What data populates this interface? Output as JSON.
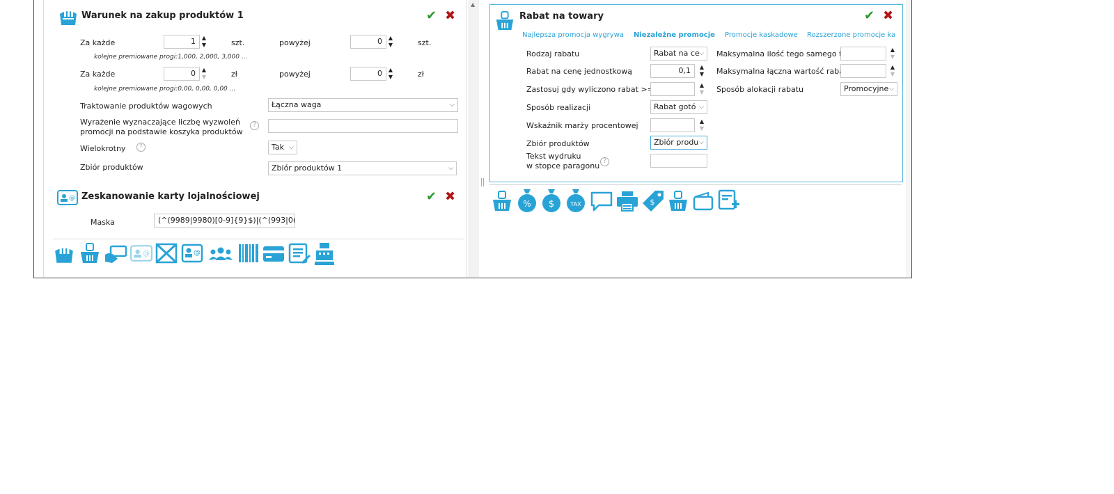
{
  "left": {
    "purchase_condition": {
      "title": "Warunek na zakup produktów 1",
      "row1": {
        "label": "Za każde",
        "value": "1",
        "unit": "szt.",
        "above_label": "powyżej",
        "above_value": "0",
        "above_unit": "szt."
      },
      "row1_note": "kolejne premiowane progi:1,000, 2,000, 3,000 ...",
      "row2": {
        "label": "Za każde",
        "value": "0",
        "unit": "zł",
        "above_label": "powyżej",
        "above_value": "0",
        "above_unit": "zł"
      },
      "row2_note": "kolejne premiowane progi:0,00, 0,00, 0,00 ...",
      "weight_label": "Traktowanie produktów wagowych",
      "weight_value": "Łączna waga",
      "expr_label_1": "Wyrażenie wyznaczające liczbę wyzwoleń",
      "expr_label_2": "promocji na podstawie koszyka produktów",
      "expr_value": "",
      "multi_label": "Wielokrotny",
      "multi_value": "Tak",
      "set_label": "Zbiór produktów",
      "set_value": "Zbiór produktów 1"
    },
    "loyalty": {
      "title": "Zeskanowanie karty lojalnościowej",
      "mask_label": "Maska",
      "mask_value": "(^(9989|9980)[0-9]{9}$)|(^(993|0("
    },
    "toolbar_icons": [
      "hand-coins-icon",
      "basket-icon",
      "card-hand-icon",
      "loyalty-card-faded-icon",
      "crossed-card-icon",
      "loyalty-status-icon",
      "group-icon",
      "barcode-icon",
      "credit-card-icon",
      "list-edit-icon",
      "cash-register-icon"
    ]
  },
  "right": {
    "discount": {
      "title": "Rabat na towary",
      "tabs": [
        "Najlepsza promocja wygrywa",
        "Niezależne promocje",
        "Promocje kaskadowe",
        "Rozszerzone promocje ka"
      ],
      "active_tab": 1,
      "type_label": "Rodzaj rabatu",
      "type_value": "Rabat na ce",
      "unit_label": "Rabat na cenę jednostkową",
      "unit_value": "0,1",
      "apply_label": "Zastosuj gdy wyliczono rabat >=",
      "apply_value": "",
      "method_label": "Sposób realizacji",
      "method_value": "Rabat gotó",
      "margin_label": "Wskaźnik marży procentowej",
      "margin_value": "",
      "set_label": "Zbiór produktów",
      "set_value": "Zbiór produ",
      "print_label_1": "Tekst wydruku",
      "print_label_2": "w stopce paragonu",
      "print_value": "",
      "max_qty_label": "Maksymalna ilość tego samego to",
      "max_qty_value": "",
      "max_val_label": "Maksymalna łączna wartość rabat",
      "max_val_value": "",
      "alloc_label": "Sposób alokacji rabatu",
      "alloc_value": "Promocyjne"
    },
    "toolbar_icons": [
      "basket-icon",
      "percent-bag-icon",
      "dollar-bag-icon",
      "tax-bag-icon",
      "speech-bubble-icon",
      "printer-icon",
      "price-tag-icon",
      "basket-outline-icon",
      "wallet-icon",
      "add-form-icon"
    ]
  },
  "colors": {
    "accent": "#29a3d6",
    "check": "#2e9b2e",
    "cross": "#b01818"
  }
}
